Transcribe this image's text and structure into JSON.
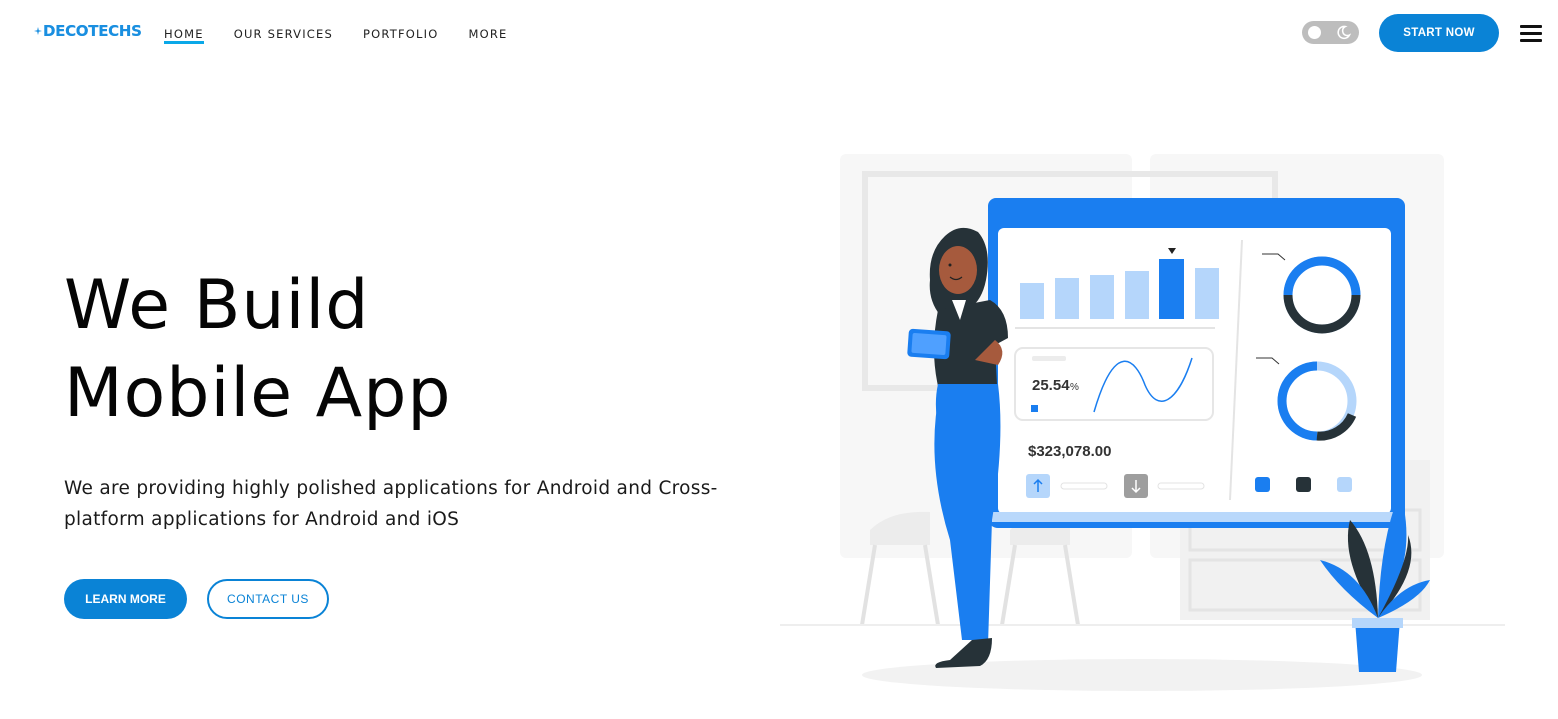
{
  "header": {
    "logo_text": "DECOTECHS",
    "nav": [
      {
        "label": "HOME",
        "active": true
      },
      {
        "label": "OUR SERVICES"
      },
      {
        "label": "PORTFOLIO"
      },
      {
        "label": "MORE"
      }
    ],
    "start_button": "START NOW"
  },
  "hero": {
    "title_line1": "We Build",
    "title_highlight": "Mobile",
    "title_rest": " App",
    "description": "We are providing highly polished applications for Android and Cross-platform applications for Android and iOS",
    "learn_more": "LEARN MORE",
    "contact_us": "CONTACT US"
  },
  "illustration": {
    "stat_percent": "25.54",
    "stat_percent_unit": "%",
    "stat_amount": "$323,078.00"
  },
  "colors": {
    "accent": "#0a83d6",
    "highlight": "#0aa8e8",
    "illustration_blue": "#1a7ef0"
  }
}
